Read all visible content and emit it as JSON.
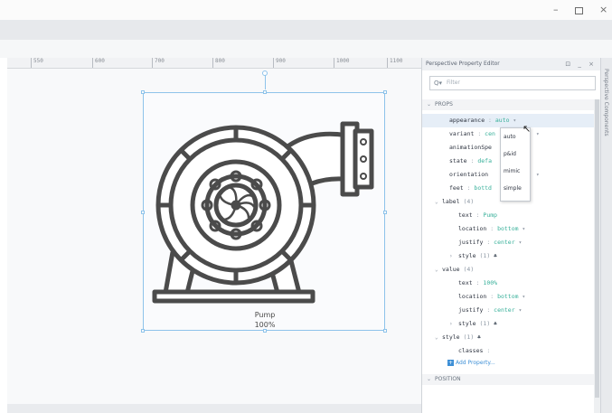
{
  "window": {
    "minimize": "–",
    "close": "×"
  },
  "ruler_ticks": [
    "550",
    "600",
    "700",
    "800",
    "900",
    "1000",
    "1100"
  ],
  "component": {
    "label": "Pump",
    "value": "100%"
  },
  "editor": {
    "title": "Perspective Property Editor",
    "header_icons": "⊡ _ ×",
    "filter_placeholder": "Filter",
    "filter_icon": "Q▾",
    "sections": {
      "props": "PROPS",
      "position": "POSITION"
    },
    "rows": [
      {
        "key": "appearance",
        "val": "auto",
        "dd": "▾"
      },
      {
        "key": "variant",
        "val": "cen",
        "dd": "▾"
      },
      {
        "key": "animationSpe",
        "val": ""
      },
      {
        "key": "state",
        "val": "defa"
      },
      {
        "key": "orientation",
        "val": "",
        "dd": "▾"
      },
      {
        "key": "feet",
        "val": "bottd"
      },
      {
        "key": "label",
        "count": "(4)"
      },
      {
        "key": "text",
        "val": "Pump"
      },
      {
        "key": "location",
        "val": "bottom",
        "dd": "▾"
      },
      {
        "key": "justify",
        "val": "center",
        "dd": "▾"
      },
      {
        "key": "style",
        "count": "(1)",
        "icon": "♣"
      },
      {
        "key": "value",
        "count": "(4)"
      },
      {
        "key": "text",
        "val": "100%"
      },
      {
        "key": "location",
        "val": "bottom",
        "dd": "▾"
      },
      {
        "key": "justify",
        "val": "center",
        "dd": "▾"
      },
      {
        "key": "style",
        "count": "(1)",
        "icon": "♣"
      },
      {
        "key": "style",
        "count": "(1)",
        "icon": "♣"
      },
      {
        "key": "classes",
        "val": ""
      }
    ],
    "add_property": "Add Property...",
    "add_icon": "+"
  },
  "dropdown_options": [
    "auto",
    "p&id",
    "mimic",
    "simple"
  ],
  "side_tab": "Perspective Components",
  "colors": {
    "accent": "#3d8fd6",
    "value_text": "#38b09a",
    "selection": "#8ec3ea"
  }
}
